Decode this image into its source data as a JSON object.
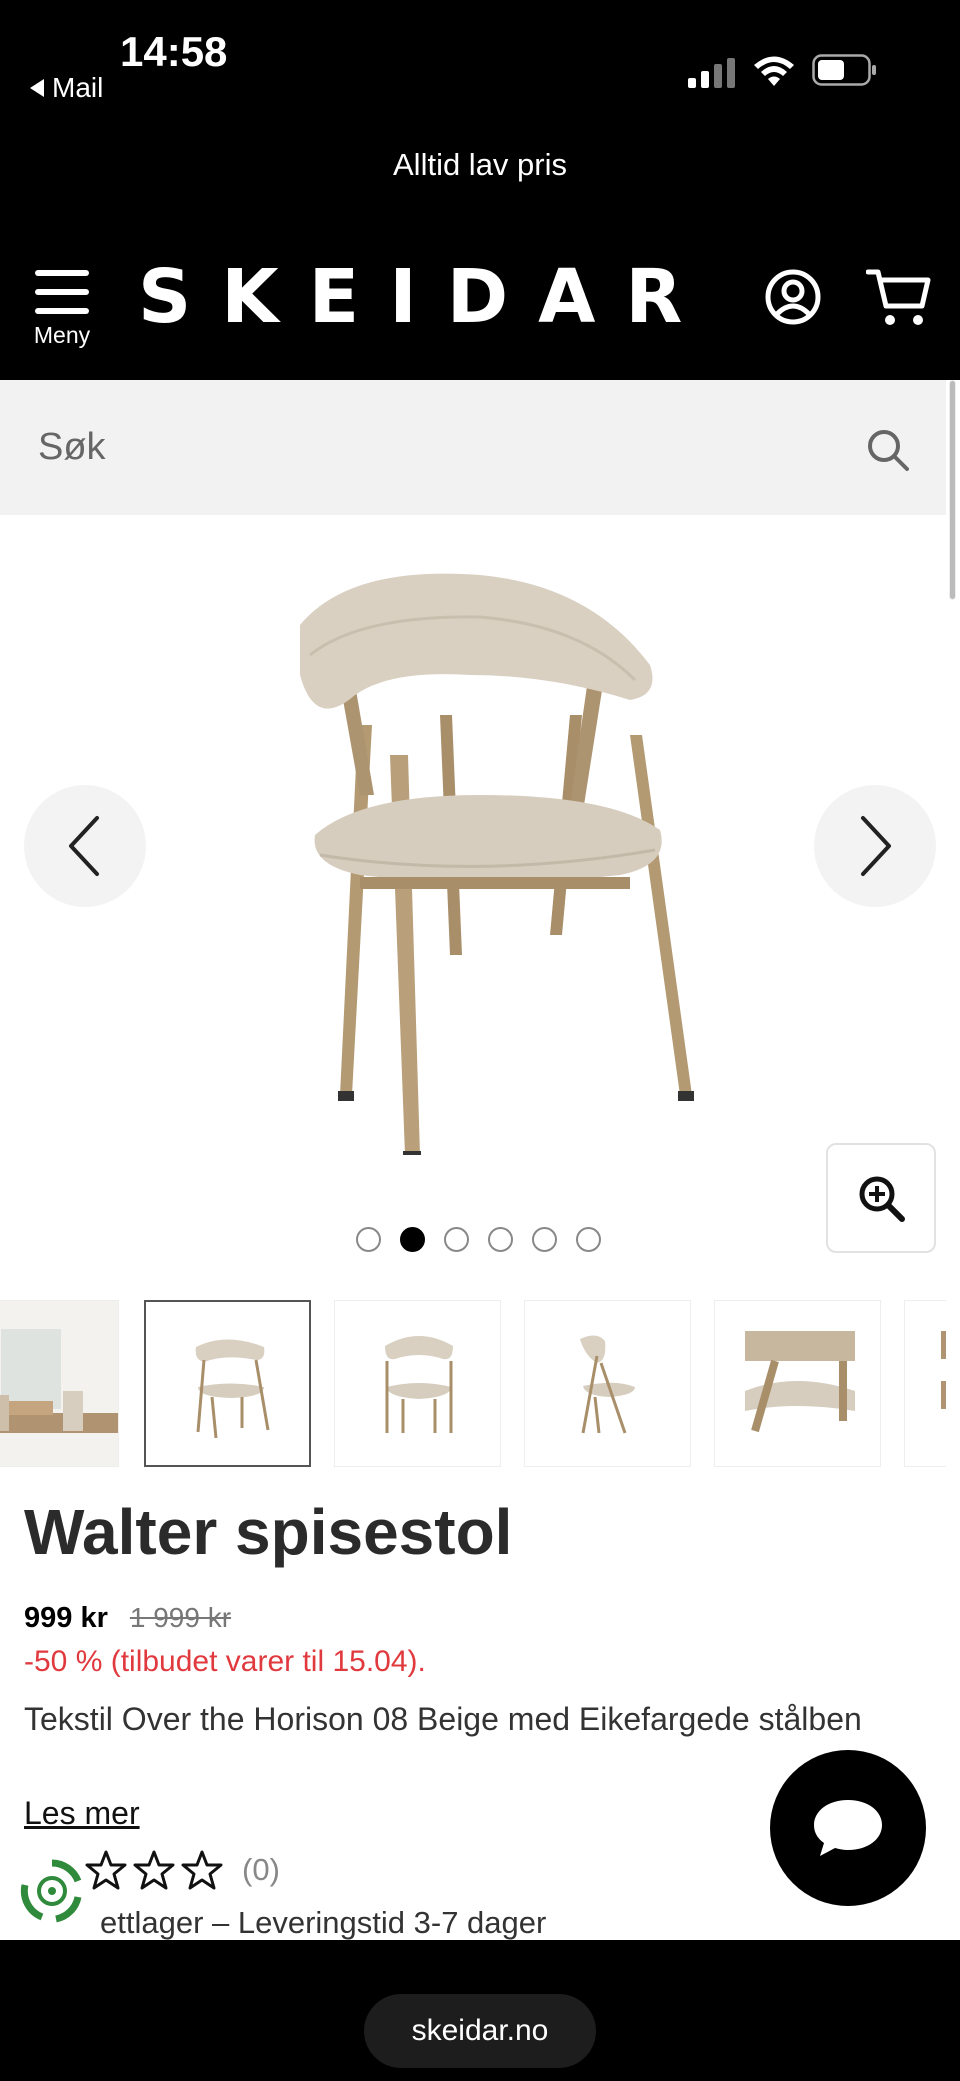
{
  "status_bar": {
    "time": "14:58",
    "back_label": "Mail"
  },
  "promo_banner": "Alltid lav pris",
  "header": {
    "menu_label": "Meny",
    "logo": "SKEIDAR"
  },
  "search": {
    "placeholder": "Søk"
  },
  "gallery": {
    "dot_count": 6,
    "active_index": 1,
    "thumbnail_count": 6,
    "selected_thumbnail": 1
  },
  "product": {
    "title": "Walter spisestol",
    "price": "999 kr",
    "old_price": "1 999 kr",
    "discount": "-50 % (tilbudet varer til 15.04).",
    "description": "Tekstil Over the Horison 08 Beige med Eikefargede stålben",
    "read_more": "Les mer",
    "rating_stars": 0,
    "review_count": "(0)",
    "stock": "ettlager – Leveringstid 3-7 dager"
  },
  "browser": {
    "url": "skeidar.no"
  },
  "colors": {
    "discount": "#e0393e",
    "header_bg": "#000000",
    "search_bg": "#f2f2f2"
  }
}
